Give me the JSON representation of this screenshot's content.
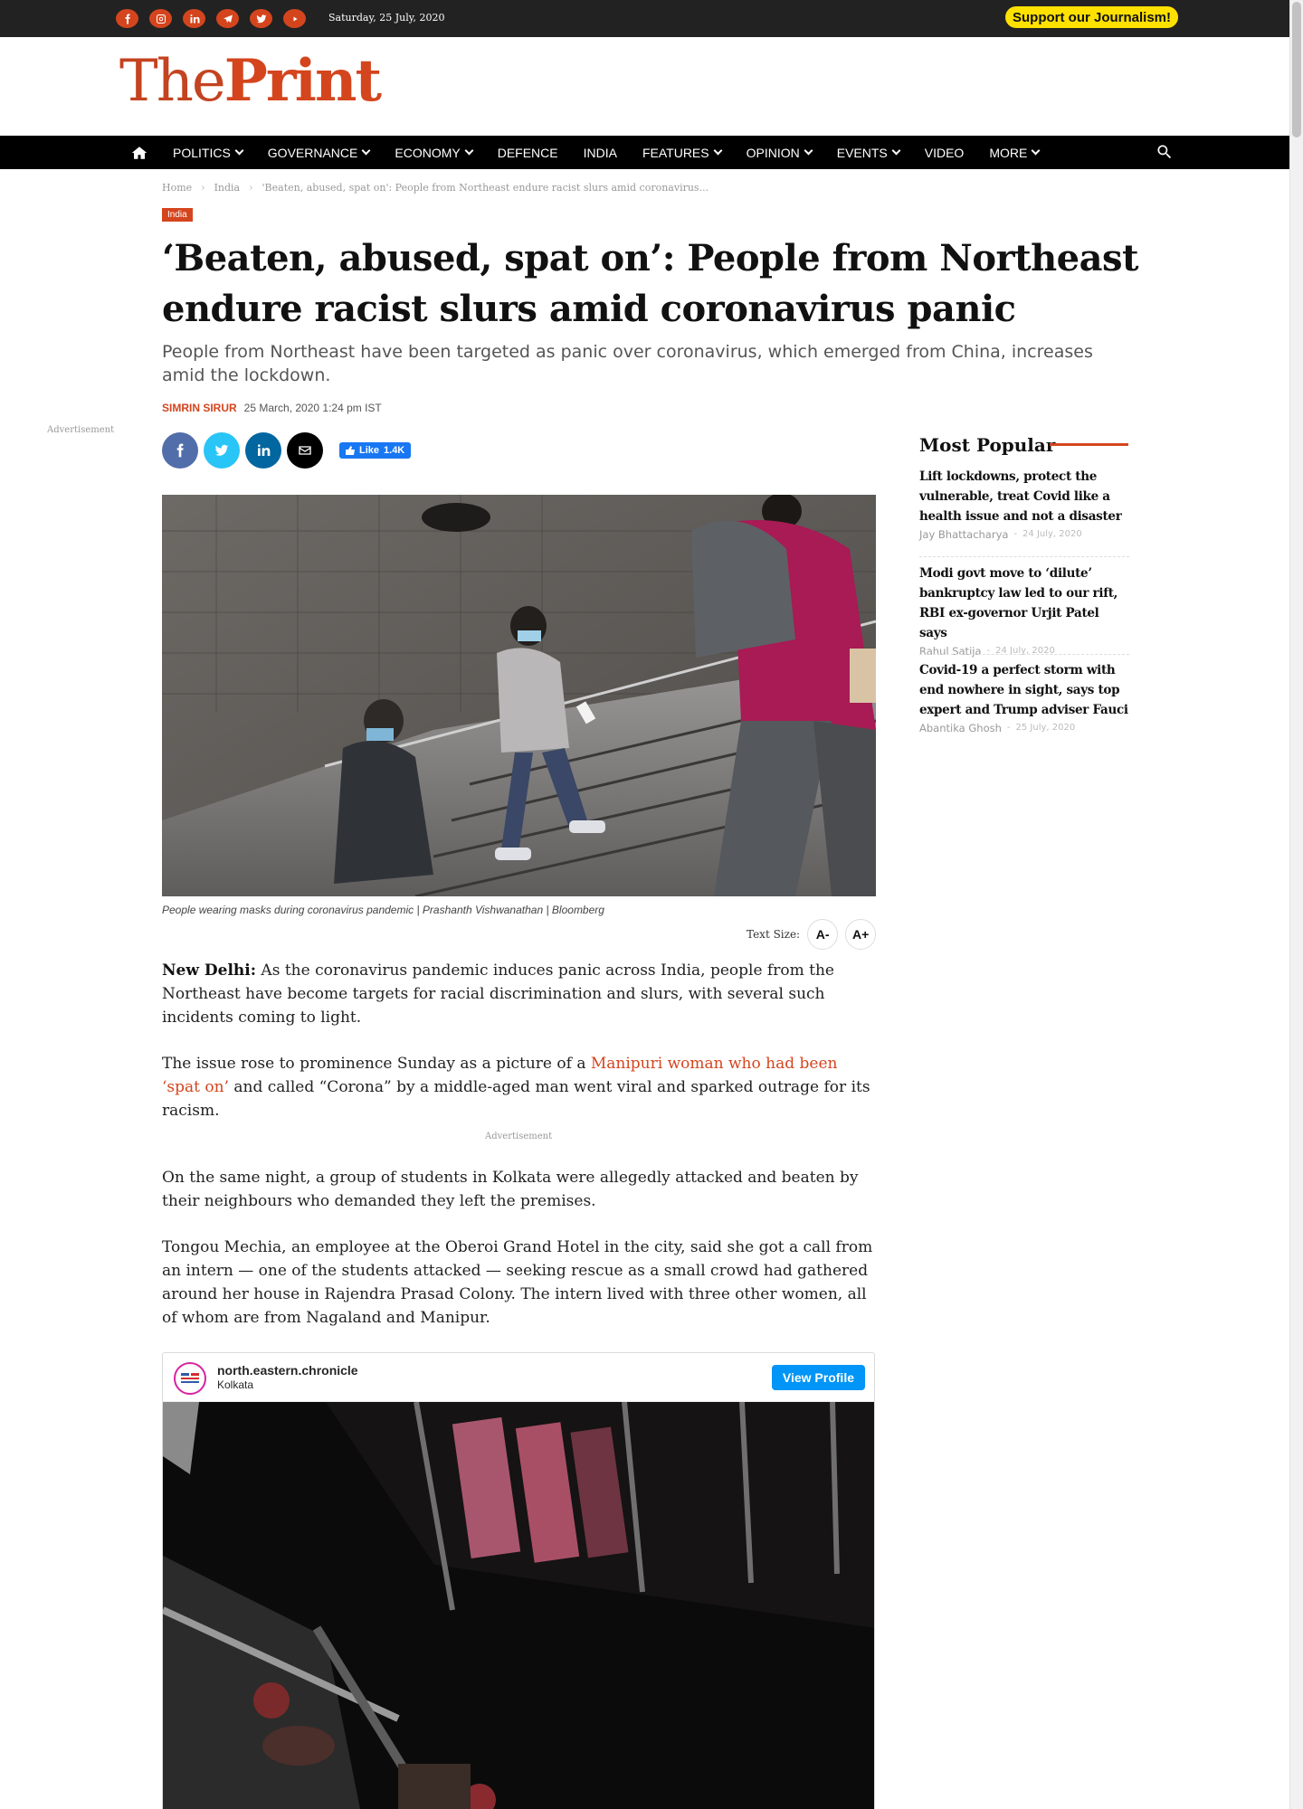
{
  "topbar": {
    "date": "Saturday, 25 July, 2020",
    "support": "Support our Journalism!",
    "social_icons": [
      "facebook-icon",
      "instagram-icon",
      "linkedin-icon",
      "telegram-icon",
      "twitter-icon",
      "youtube-icon"
    ],
    "accent_color": "#d4451e"
  },
  "logo": {
    "part1": "The",
    "part2": "Print"
  },
  "nav": {
    "items": [
      {
        "label": "POLITICS",
        "dropdown": true
      },
      {
        "label": "GOVERNANCE",
        "dropdown": true
      },
      {
        "label": "ECONOMY",
        "dropdown": true
      },
      {
        "label": "DEFENCE",
        "dropdown": false
      },
      {
        "label": "INDIA",
        "dropdown": false
      },
      {
        "label": "FEATURES",
        "dropdown": true
      },
      {
        "label": "OPINION",
        "dropdown": true
      },
      {
        "label": "EVENTS",
        "dropdown": true
      },
      {
        "label": "VIDEO",
        "dropdown": false
      },
      {
        "label": "MORE",
        "dropdown": true
      }
    ]
  },
  "breadcrumb": {
    "home": "Home",
    "section": "India",
    "current": "'Beaten, abused, spat on': People from Northeast endure racist slurs amid coronavirus..."
  },
  "article": {
    "category": "India",
    "headline": "‘Beaten, abused, spat on’: People from Northeast endure racist slurs amid coronavirus panic",
    "dek": "People from Northeast have been targeted as panic over coronavirus, which emerged from China, increases amid the lockdown.",
    "author": "SIMRIN SIRUR",
    "date": "25 March, 2020 1:24 pm IST",
    "fb_like": "Like",
    "fb_count": "1.4K",
    "caption": "People wearing masks during coronavirus pandemic | Prashanth Vishwanathan | Bloomberg",
    "text_size_label": "Text Size:",
    "text_size_minus": "A-",
    "text_size_plus": "A+",
    "p1_lead": "New Delhi:",
    "p1_rest": " As the coronavirus pandemic induces panic across India, people from the Northeast have become targets for racial discrimination and slurs, with several such incidents coming to light.",
    "p2_start": "The issue rose to prominence Sunday as a picture of a ",
    "p2_link": "Manipuri woman who had been ‘spat on’",
    "p2_end": " and called “Corona” by a middle-aged man went viral and sparked outrage for its racism.",
    "advertisement": "Advertisement",
    "p3": "On the same night, a group of students in Kolkata were allegedly attacked and beaten by their neighbours who demanded they left the premises.",
    "p4": "Tongou Mechia, an employee at the Oberoi Grand Hotel in the city, said she got a call from an intern — one of the students attacked — seeking rescue as a small crowd had gathered around her house in Rajendra Prasad Colony. The intern lived with three other women, all of whom are from Nagaland and Manipur."
  },
  "side_advertisement": "Advertisement",
  "instagram": {
    "username": "north.eastern.chronicle",
    "location": "Kolkata",
    "button": "View Profile"
  },
  "most_popular": {
    "title": "Most Popular",
    "items": [
      {
        "title": "Lift lockdowns, protect the vulnerable, treat Covid like a health issue and not a disaster",
        "author": "Jay Bhattacharya",
        "date": "24 July, 2020"
      },
      {
        "title": "Modi govt move to ‘dilute’ bankruptcy law led to our rift, RBI ex-governor Urjit Patel says",
        "author": "Rahul Satija",
        "date": "24 July, 2020"
      },
      {
        "title": "Covid-19 a perfect storm with end nowhere in sight, says top expert and Trump adviser Fauci",
        "author": "Abantika Ghosh",
        "date": "25 July, 2020"
      }
    ]
  }
}
